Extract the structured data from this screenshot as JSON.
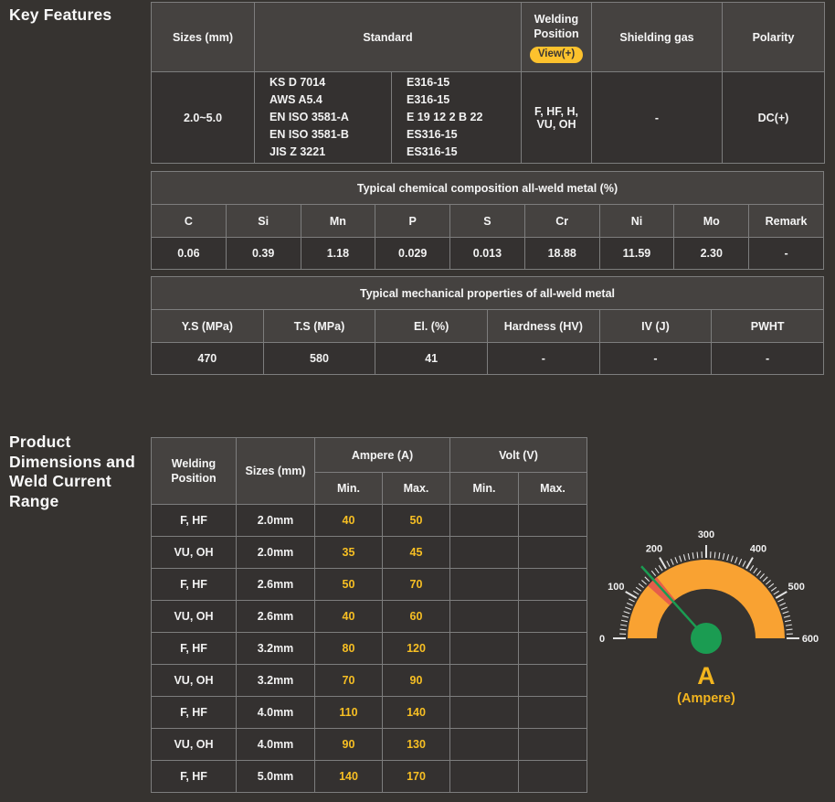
{
  "colors": {
    "page_bg": "#363330",
    "cell_bg": "#343130",
    "header_bg": "#454240",
    "border": "#7d7d7d",
    "text": "#f2f2f2",
    "yellow_value": "#f7bf23",
    "pill_bg": "#fdc22d"
  },
  "headings": {
    "key_features": "Key Features",
    "product_dimensions": "Product Dimensions and Weld Current Range"
  },
  "features_table": {
    "headers": {
      "sizes": "Sizes (mm)",
      "standard": "Standard",
      "welding_position": "Welding Position",
      "view_button": "View(+)",
      "shielding_gas": "Shielding gas",
      "polarity": "Polarity"
    },
    "row": {
      "sizes": "2.0~5.0",
      "standards_left": [
        "KS D 7014",
        "AWS A5.4",
        "EN ISO 3581-A",
        "EN ISO 3581-B",
        "JIS Z 3221"
      ],
      "standards_right": [
        "E316-15",
        "E316-15",
        "E 19 12 2 B 22",
        "ES316-15",
        "ES316-15"
      ],
      "welding_position": "F, HF, H, VU, OH",
      "shielding_gas": "-",
      "polarity": "DC(+)"
    }
  },
  "chemical_table": {
    "title": "Typical chemical composition all-weld metal (%)",
    "headers": [
      "C",
      "Si",
      "Mn",
      "P",
      "S",
      "Cr",
      "Ni",
      "Mo",
      "Remark"
    ],
    "values": [
      "0.06",
      "0.39",
      "1.18",
      "0.029",
      "0.013",
      "18.88",
      "11.59",
      "2.30",
      "-"
    ]
  },
  "mechanical_table": {
    "title": "Typical mechanical properties of all-weld metal",
    "headers": [
      "Y.S (MPa)",
      "T.S (MPa)",
      "El. (%)",
      "Hardness (HV)",
      "IV (J)",
      "PWHT"
    ],
    "values": [
      "470",
      "580",
      "41",
      "-",
      "-",
      "-"
    ]
  },
  "current_table": {
    "headers": {
      "welding_position": "Welding Position",
      "sizes": "Sizes (mm)",
      "ampere": "Ampere (A)",
      "volt": "Volt (V)",
      "min": "Min.",
      "max": "Max."
    },
    "rows": [
      {
        "position": "F, HF",
        "size": "2.0mm",
        "amp_min": "40",
        "amp_max": "50",
        "volt_min": "",
        "volt_max": ""
      },
      {
        "position": "VU, OH",
        "size": "2.0mm",
        "amp_min": "35",
        "amp_max": "45",
        "volt_min": "",
        "volt_max": ""
      },
      {
        "position": "F, HF",
        "size": "2.6mm",
        "amp_min": "50",
        "amp_max": "70",
        "volt_min": "",
        "volt_max": ""
      },
      {
        "position": "VU, OH",
        "size": "2.6mm",
        "amp_min": "40",
        "amp_max": "60",
        "volt_min": "",
        "volt_max": ""
      },
      {
        "position": "F, HF",
        "size": "3.2mm",
        "amp_min": "80",
        "amp_max": "120",
        "volt_min": "",
        "volt_max": ""
      },
      {
        "position": "VU, OH",
        "size": "3.2mm",
        "amp_min": "70",
        "amp_max": "90",
        "volt_min": "",
        "volt_max": ""
      },
      {
        "position": "F, HF",
        "size": "4.0mm",
        "amp_min": "110",
        "amp_max": "140",
        "volt_min": "",
        "volt_max": ""
      },
      {
        "position": "VU, OH",
        "size": "4.0mm",
        "amp_min": "90",
        "amp_max": "130",
        "volt_min": "",
        "volt_max": ""
      },
      {
        "position": "F, HF",
        "size": "5.0mm",
        "amp_min": "140",
        "amp_max": "170",
        "volt_min": "",
        "volt_max": ""
      }
    ]
  },
  "gauge": {
    "min": 0,
    "max": 600,
    "minor_step": 10,
    "major_step": 100,
    "major_tick_labels": [
      "0",
      "100",
      "200",
      "300",
      "400",
      "500",
      "600"
    ],
    "needle_value": 160,
    "highlight_min": 140,
    "highlight_max": 170,
    "unit": "A",
    "unit_caption": "(Ampere)",
    "colors": {
      "band": "#f9a232",
      "highlight": "#e2574c",
      "tick": "#e3e3e3",
      "label": "#f0f0f0",
      "needle": "#1b9c52",
      "hub": "#1b9c52",
      "unit": "#f3b51e"
    }
  }
}
